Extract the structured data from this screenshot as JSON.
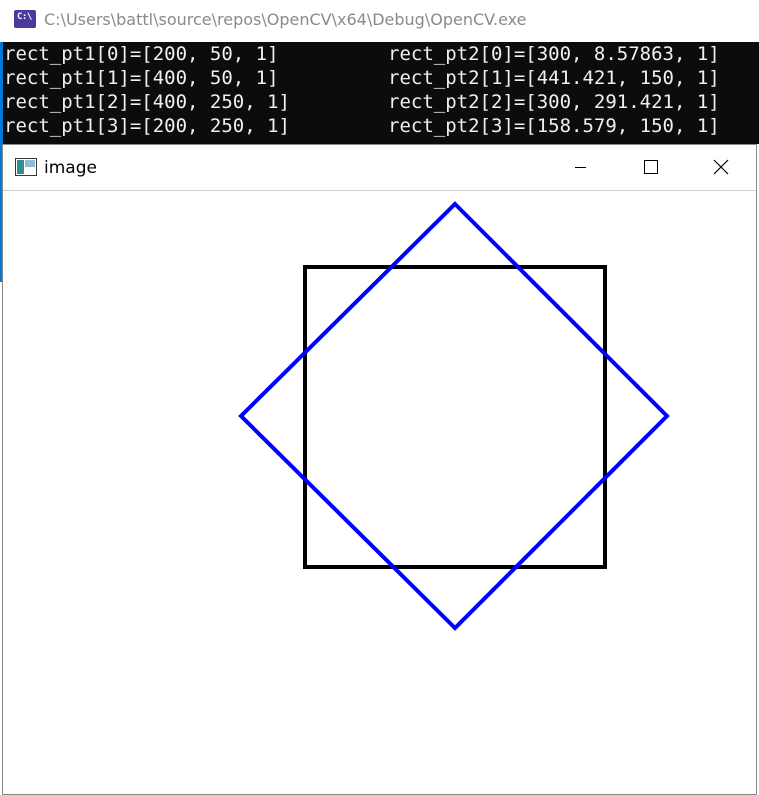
{
  "console": {
    "title": "C:\\Users\\battl\\source\\repos\\OpenCV\\x64\\Debug\\OpenCV.exe",
    "icon_text": "C:\\",
    "lines": [
      {
        "left": "rect_pt1[0]=[200, 50, 1]",
        "right": "rect_pt2[0]=[300, 8.57863, 1]"
      },
      {
        "left": "rect_pt1[1]=[400, 50, 1]",
        "right": "rect_pt2[1]=[441.421, 150, 1]"
      },
      {
        "left": "rect_pt1[2]=[400, 250, 1]",
        "right": "rect_pt2[2]=[300, 291.421, 1]"
      },
      {
        "left": "rect_pt1[3]=[200, 250, 1]",
        "right": "rect_pt2[3]=[158.579, 150, 1]"
      }
    ]
  },
  "image_window": {
    "title": "image",
    "controls": [
      "minimize-icon",
      "maximize-icon",
      "close-icon"
    ],
    "rect_color": "#000000",
    "rotated_rect_color": "#0000ff"
  }
}
